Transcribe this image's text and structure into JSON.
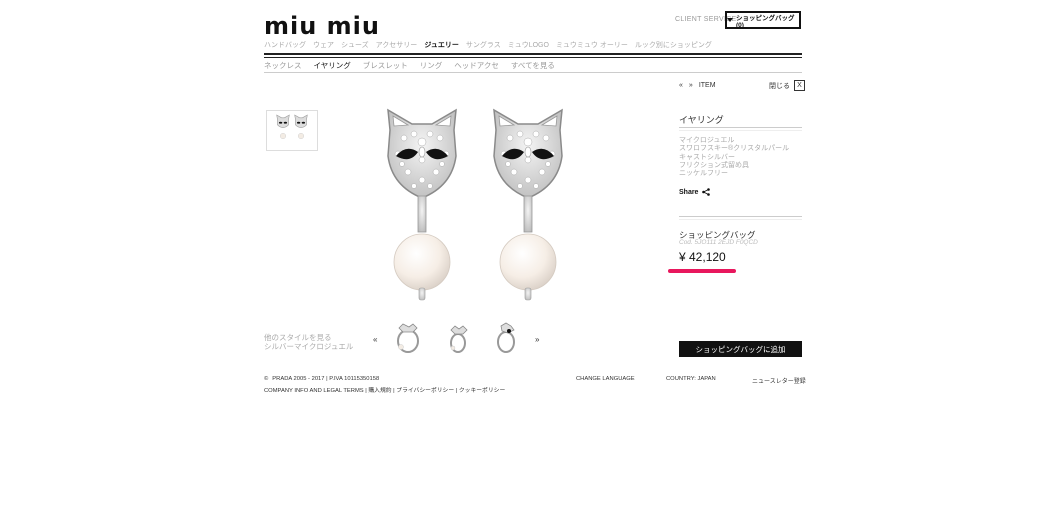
{
  "brand": {
    "logo_text": "miu miu"
  },
  "header": {
    "client_service": "CLIENT SERVICE",
    "bag_button": "ショッピングバッグ (0)"
  },
  "main_nav": [
    {
      "label": "ハンドバッグ",
      "active": false
    },
    {
      "label": "ウェア",
      "active": false
    },
    {
      "label": "シューズ",
      "active": false
    },
    {
      "label": "アクセサリー",
      "active": false
    },
    {
      "label": "ジュエリー",
      "active": true
    },
    {
      "label": "サングラス",
      "active": false
    },
    {
      "label": "ミュウLOGO",
      "active": false
    },
    {
      "label": "ミュウミュウ オーリー",
      "active": false
    },
    {
      "label": "ルック別にショッピング",
      "active": false
    }
  ],
  "sub_nav": [
    {
      "label": "ネックレス",
      "active": false
    },
    {
      "label": "イヤリング",
      "active": true
    },
    {
      "label": "ブレスレット",
      "active": false
    },
    {
      "label": "リング",
      "active": false
    },
    {
      "label": "ヘッドアクセ",
      "active": false
    },
    {
      "label": "すべてを見る",
      "active": false
    }
  ],
  "other_styles": {
    "line1": "他のスタイルを見る",
    "line2": "シルバーマイクロジュエル",
    "prev": "«",
    "next": "»"
  },
  "pager": {
    "prev": "«",
    "next": "»",
    "label": "ITEM"
  },
  "close": {
    "label": "閉じる",
    "icon_glyph": "X"
  },
  "product": {
    "title": "イヤリング",
    "description": [
      "マイクロジュエル",
      "スワロフスキー®クリスタルパール",
      "キャストシルバー",
      "フリクション式留め具",
      "ニッケルフリー"
    ],
    "share": "Share",
    "bag_label": "ショッピングバッグ",
    "code": "Cod. 5JO111 2EJD F0QCD",
    "price": "¥ 42,120",
    "add_button": "ショッピングバッグに追加"
  },
  "footer": {
    "copyright": "PRADA 2005 - 2017 | P.IVA 10115350158",
    "legal": "COMPANY INFO AND LEGAL TERMS | 購入規約 | プライバシーポリシー | クッキーポリシー",
    "change_language": "CHANGE LANGUAGE",
    "country": "COUNTRY: JAPAN",
    "newsletter": "ニュースレター登録"
  },
  "colors": {
    "accent_underline": "#e8175d",
    "button_bg": "#111111"
  }
}
